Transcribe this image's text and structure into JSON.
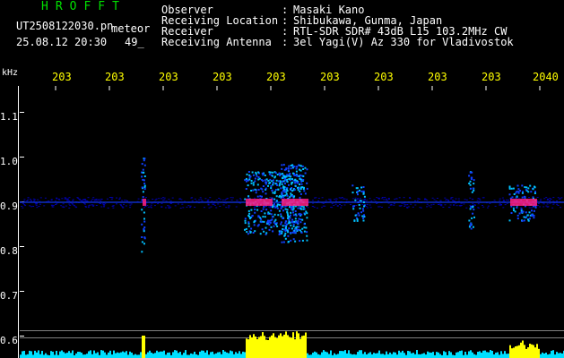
{
  "header": {
    "brand": "HROFFT",
    "filename": "UT2508122030.pn",
    "subtitle": "meteor",
    "timestamp": "25.08.12 20:30",
    "count": "49_"
  },
  "info": [
    {
      "label": "Observer",
      "value": "Masaki Kano"
    },
    {
      "label": "Receiving Location",
      "value": "Shibukawa, Gunma, Japan"
    },
    {
      "label": "Receiver",
      "value": "RTL-SDR SDR# 43dB L15 103.2MHz CW"
    },
    {
      "label": "Receiving Antenna",
      "value": "3el Yagi(V) Az 330 for Vladivostok"
    }
  ],
  "separator": ":",
  "axis": {
    "unit": "kHz",
    "y_ticks": [
      "1.1",
      "1.0",
      "0.9",
      "0.8",
      "0.7",
      "0.6"
    ],
    "x_ticks": [
      "203",
      "203",
      "203",
      "203",
      "203",
      "203",
      "203",
      "203",
      "203",
      "2040"
    ]
  },
  "colors": {
    "background": "#000000",
    "brand": "#00e000",
    "tick_x": "#ffff00",
    "noise": "#0000b0",
    "signal": "#ff2080",
    "histogram": "#ffff00",
    "histogram_base": "#00e0ff"
  }
}
